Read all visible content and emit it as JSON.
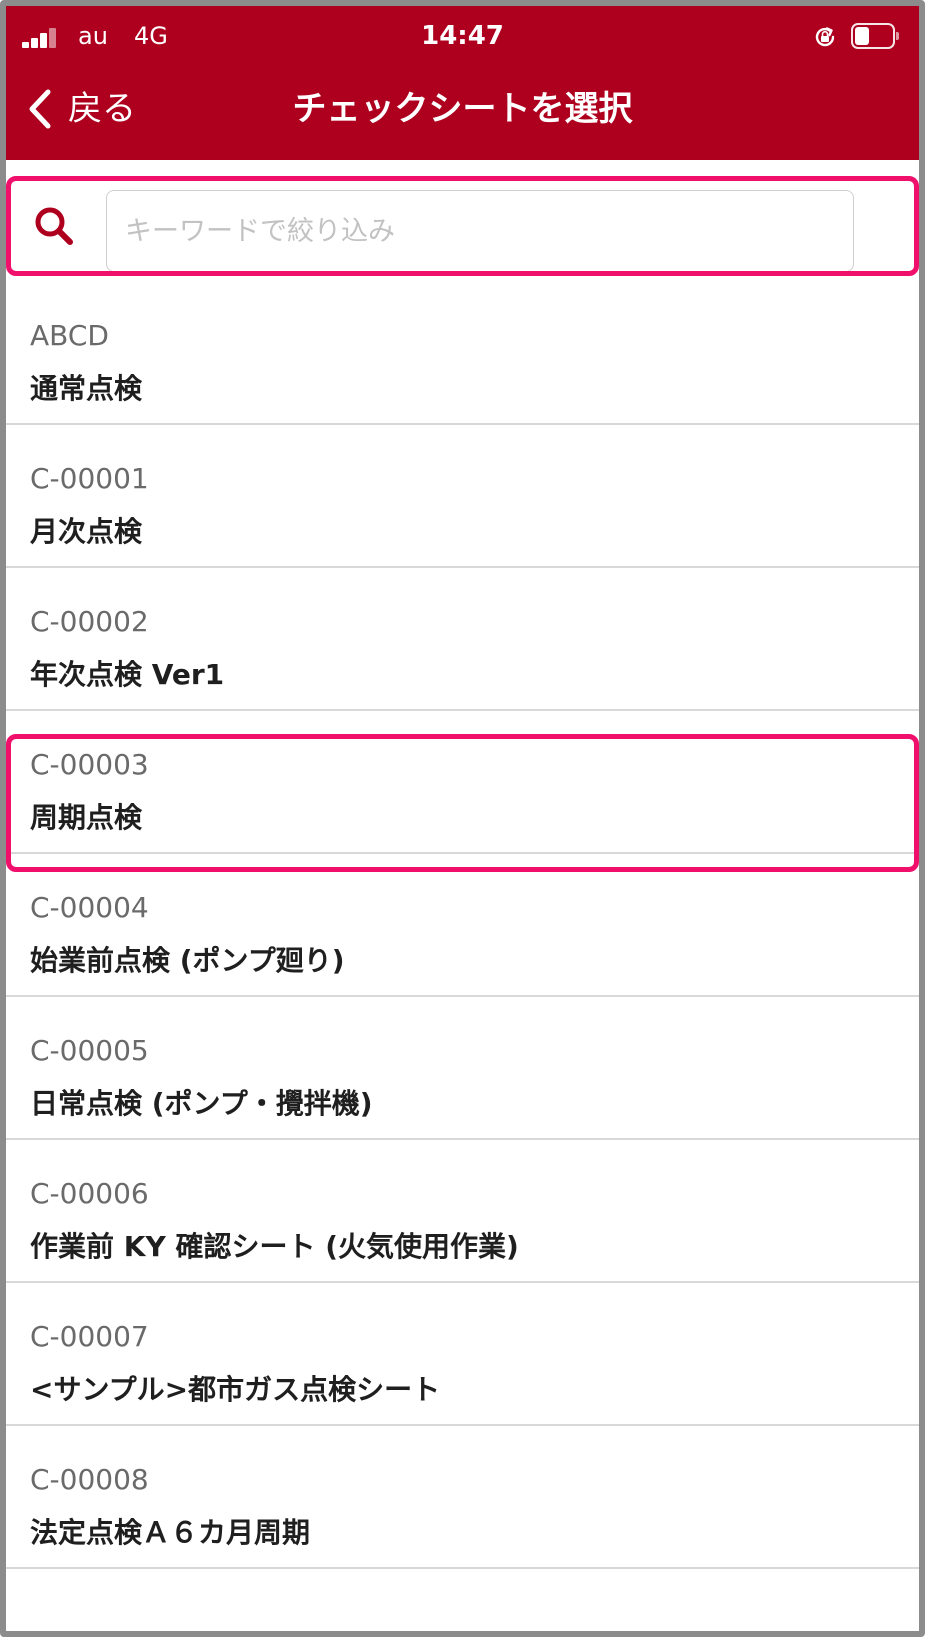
{
  "status_bar": {
    "carrier": "au",
    "network": "4G",
    "time": "14:47"
  },
  "nav": {
    "back_label": "戻る",
    "title": "チェックシートを選択"
  },
  "search": {
    "placeholder": "キーワードで絞り込み",
    "value": ""
  },
  "items": [
    {
      "code": "ABCD",
      "name": "通常点検"
    },
    {
      "code": "C-00001",
      "name": "月次点検"
    },
    {
      "code": "C-00002",
      "name": "年次点検 Ver1"
    },
    {
      "code": "C-00003",
      "name": "周期点検"
    },
    {
      "code": "C-00004",
      "name": "始業前点検 (ポンプ廻り)"
    },
    {
      "code": "C-00005",
      "name": "日常点検 (ポンプ・攪拌機)"
    },
    {
      "code": "C-00006",
      "name": "作業前 KY 確認シート (火気使用作業)"
    },
    {
      "code": "C-00007",
      "name": "<サンプル>都市ガス点検シート"
    },
    {
      "code": "C-00008",
      "name": "法定点検Ａ６カ月周期"
    }
  ],
  "colors": {
    "header_bg": "#ae001e",
    "highlight": "#f0106c",
    "search_icon": "#ae001e"
  }
}
